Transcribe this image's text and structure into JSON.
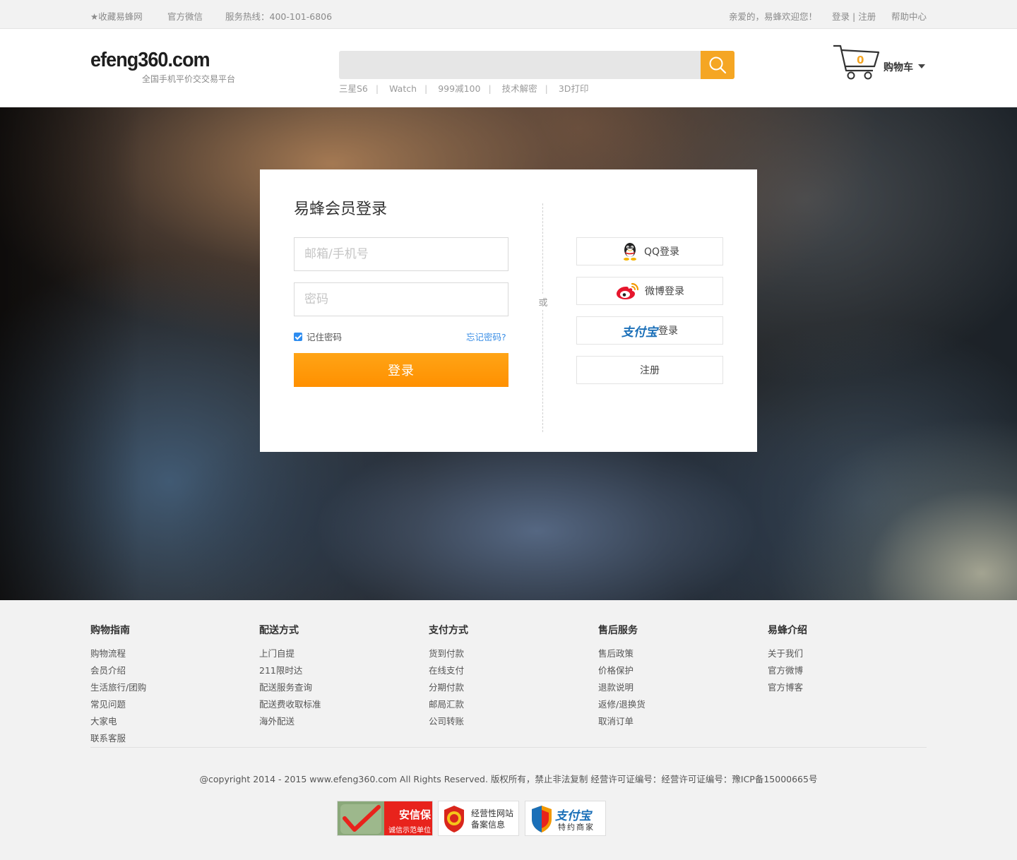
{
  "topbar": {
    "favorite": "收藏易蜂网",
    "wechat": "官方微信",
    "hotline": "服务热线：400-101-6806",
    "welcome": "亲爱的，易蜂欢迎您！",
    "login": "登录",
    "divider": "|",
    "register": "注册",
    "help": "帮助中心"
  },
  "header": {
    "logo": "efeng360.com",
    "tagline": "全国手机平价交交易平台",
    "search_placeholder": "",
    "hotwords": [
      "三星S6",
      "Watch",
      "999减100",
      "技术解密",
      "3D打印"
    ],
    "cart_count": "0",
    "cart_label": "购物车"
  },
  "login": {
    "title": "易蜂会员登录",
    "account_placeholder": "邮箱/手机号",
    "password_placeholder": "密码",
    "remember": "记住密码",
    "remember_checked": true,
    "forgot": "忘记密码?",
    "submit": "登录",
    "or": "或",
    "qq": "QQ登录",
    "weibo": "微博登录",
    "alipay_brand": "支付宝",
    "alipay": "登录",
    "register": "注册"
  },
  "footer": {
    "columns": [
      {
        "title": "购物指南",
        "links": [
          "购物流程",
          "会员介绍",
          "生活旅行/团购",
          "常见问题",
          "大家电",
          "联系客服"
        ]
      },
      {
        "title": "配送方式",
        "links": [
          "上门自提",
          "211限时达",
          "配送服务查询",
          "配送费收取标准",
          "海外配送"
        ]
      },
      {
        "title": "支付方式",
        "links": [
          "货到付款",
          "在线支付",
          "分期付款",
          "邮局汇款",
          "公司转账"
        ]
      },
      {
        "title": "售后服务",
        "links": [
          "售后政策",
          "价格保护",
          "退款说明",
          "返修/退换货",
          "取消订单"
        ]
      },
      {
        "title": "易蜂介绍",
        "links": [
          "关于我们",
          "官方微博",
          "官方博客"
        ]
      }
    ],
    "copyright": "@copyright 2014 - 2015 www.efeng360.com All Rights Reserved. 版权所有，禁止非法复制 经营许可证编号：经营许可证编号：豫ICP备15000665号",
    "badges": {
      "anxin_title": "安信保",
      "anxin_sub": "诚信示范单位",
      "record_line1": "经营性网站",
      "record_line2": "备案信息",
      "alipay_brand": "支付宝",
      "alipay_sub": "特约商家"
    }
  },
  "colors": {
    "accent": "#f5a623",
    "button": "#ff9a0a",
    "link": "#3a8ee6",
    "topbar_bg": "#f2f2f2",
    "footer_bg": "#f2f2f2"
  }
}
